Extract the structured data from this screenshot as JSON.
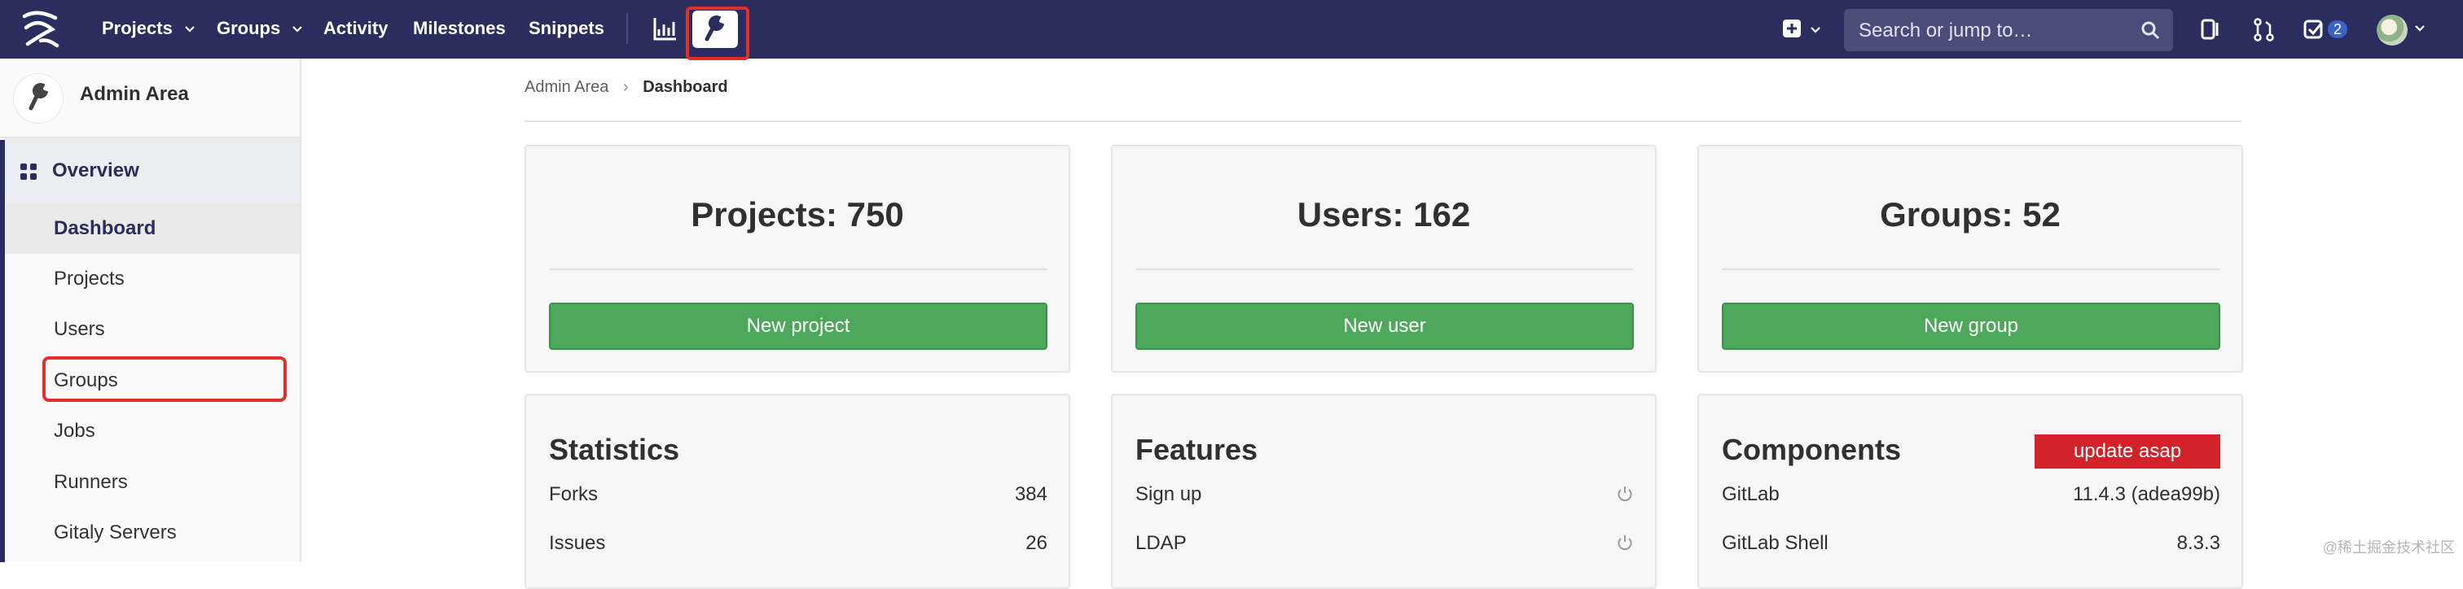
{
  "nav": {
    "links": [
      "Projects",
      "Groups",
      "Activity",
      "Milestones",
      "Snippets"
    ],
    "search_placeholder": "Search or jump to…",
    "todo_count": "2"
  },
  "sidebar": {
    "context_title": "Admin Area",
    "section_label": "Overview",
    "items": [
      "Dashboard",
      "Projects",
      "Users",
      "Groups",
      "Jobs",
      "Runners",
      "Gitaly Servers"
    ]
  },
  "breadcrumb": {
    "parent": "Admin Area",
    "current": "Dashboard"
  },
  "cards": [
    {
      "title": "Projects: 750",
      "button": "New project"
    },
    {
      "title": "Users: 162",
      "button": "New user"
    },
    {
      "title": "Groups: 52",
      "button": "New group"
    }
  ],
  "statistics": {
    "title": "Statistics",
    "rows": [
      {
        "label": "Forks",
        "value": "384"
      },
      {
        "label": "Issues",
        "value": "26"
      }
    ]
  },
  "features": {
    "title": "Features",
    "rows": [
      {
        "label": "Sign up"
      },
      {
        "label": "LDAP"
      }
    ]
  },
  "components": {
    "title": "Components",
    "badge": "update asap",
    "rows": [
      {
        "label": "GitLab",
        "value": "11.4.3 (adea99b)"
      },
      {
        "label": "GitLab Shell",
        "value": "8.3.3"
      }
    ]
  },
  "watermark": "@稀土掘金技术社区",
  "colors": {
    "nav_bg": "#2b2d5e",
    "button_green": "#4ea85c",
    "badge_red": "#d2232a",
    "highlight": "#e0302a"
  }
}
